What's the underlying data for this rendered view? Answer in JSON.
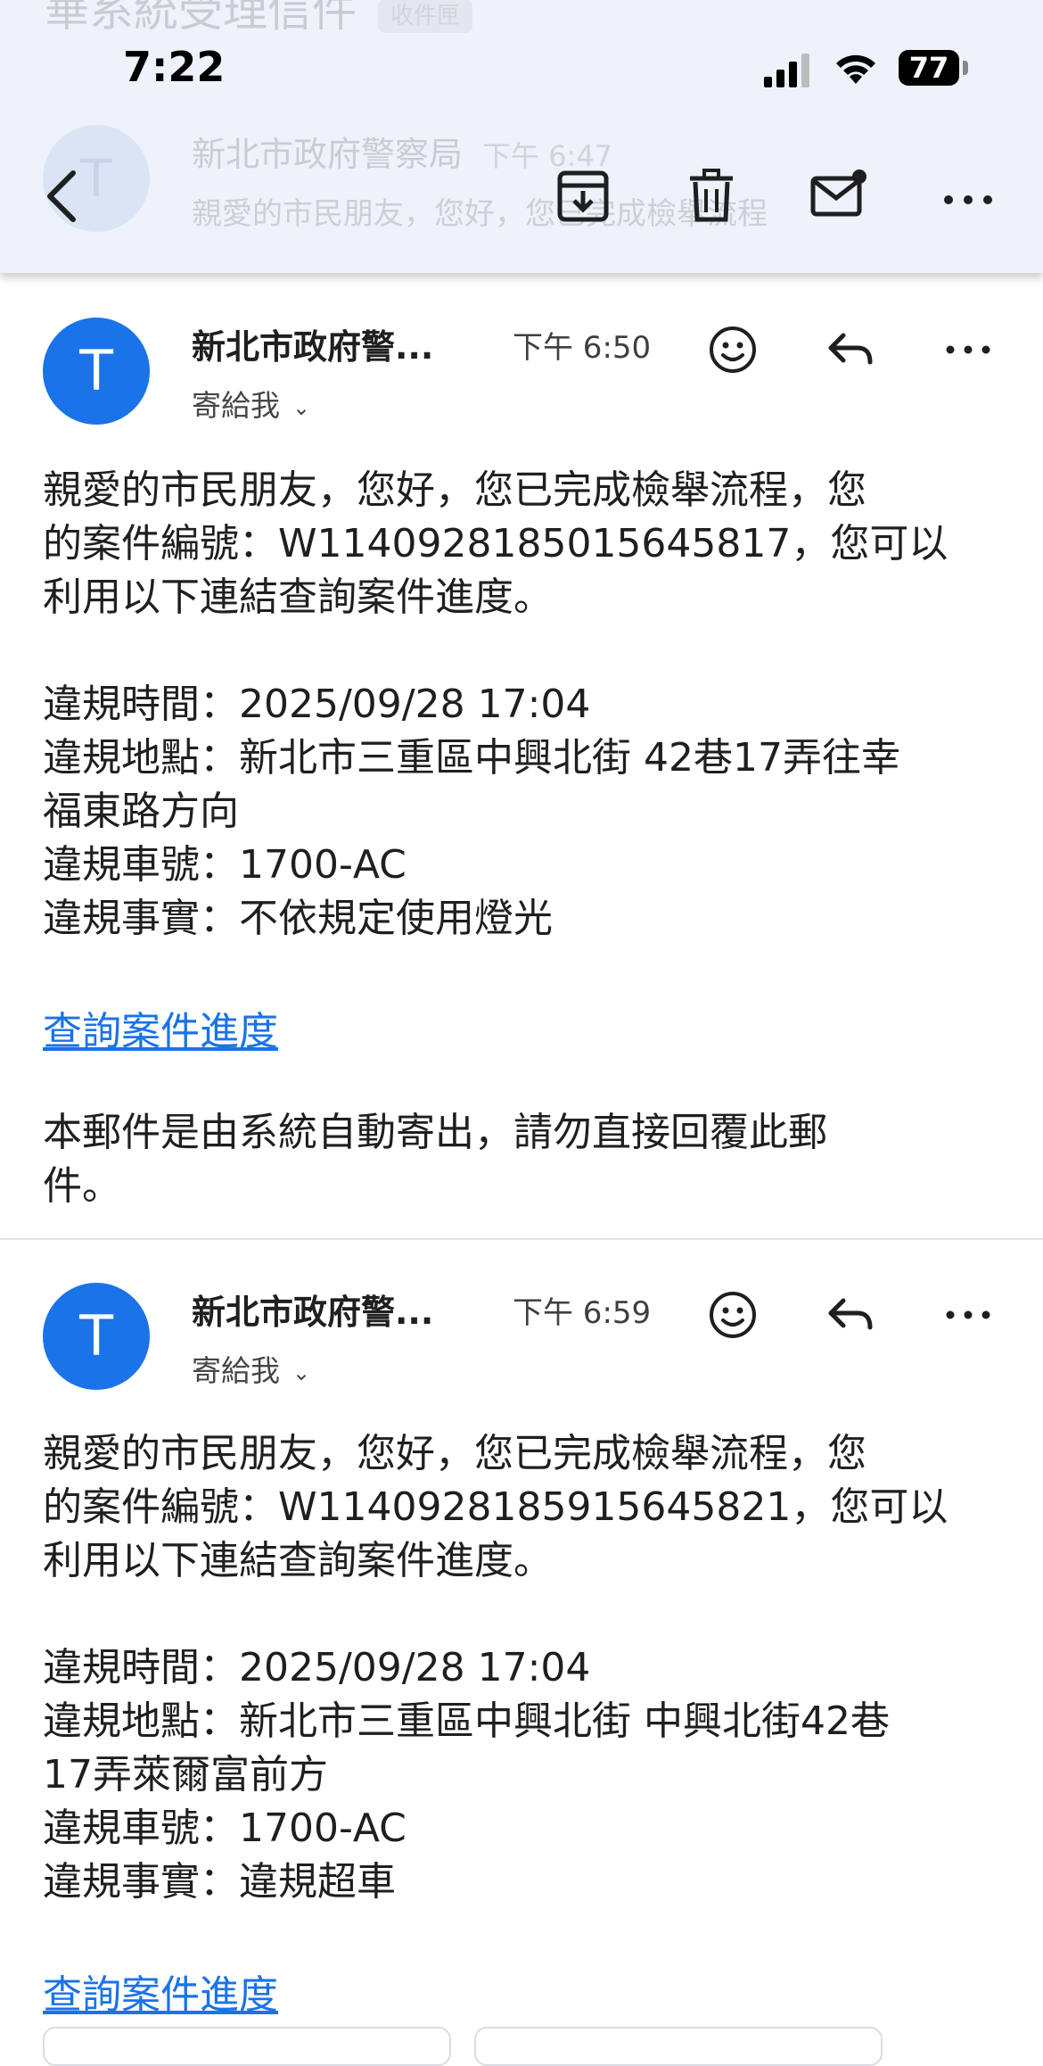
{
  "header": {
    "bg_subject": "華系統受理信件",
    "bg_chip": "收件匣",
    "bg_avatar_letter": "T",
    "bg_sender": "新北市政府警察局",
    "bg_time": "下午 6:47",
    "bg_snippet": "親愛的市民朋友，您好，您已完成檢舉流程"
  },
  "status_bar": {
    "time": "7:22",
    "battery": "77"
  },
  "toolbar": {
    "icons": [
      "back-arrow-icon",
      "archive-icon",
      "trash-icon",
      "mark-unread-icon",
      "more-vert-icon"
    ]
  },
  "messages": [
    {
      "avatar_letter": "T",
      "sender": "新北市政府警...",
      "time": "下午 6:50",
      "to_label": "寄給我",
      "chevron": "⌄",
      "body_lines": [
        "親愛的市民朋友，您好，您已完成檢舉流程，您",
        "的案件編號：W1140928185015645817，您可以",
        "利用以下連結查詢案件進度。",
        "違規時間：2025/09/28 17:04",
        "違規地點：新北市三重區中興北街 42巷17弄往幸",
        "福東路方向",
        "違規車號：1700-AC",
        "違規事實：不依規定使用燈光"
      ],
      "link": "查詢案件進度",
      "footer_lines": [
        "本郵件是由系統自動寄出，請勿直接回覆此郵",
        "件。"
      ]
    },
    {
      "avatar_letter": "T",
      "sender": "新北市政府警...",
      "time": "下午 6:59",
      "to_label": "寄給我",
      "chevron": "⌄",
      "body_lines": [
        "親愛的市民朋友，您好，您已完成檢舉流程，您",
        "的案件編號：W1140928185915645821，您可以",
        "利用以下連結查詢案件進度。",
        "違規時間：2025/09/28 17:04",
        "違規地點：新北市三重區中興北街 中興北街42巷",
        "17弄萊爾富前方",
        "違規車號：1700-AC",
        "違規事實：違規超車"
      ],
      "link": "查詢案件進度"
    }
  ]
}
